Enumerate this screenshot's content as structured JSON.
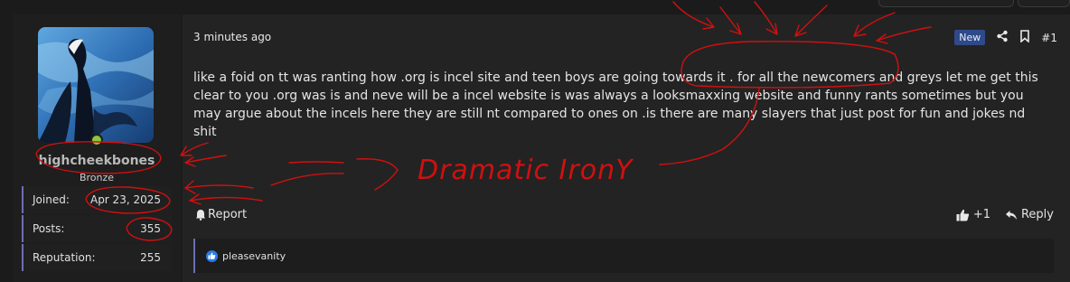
{
  "post": {
    "time": "3 minutes ago",
    "new_badge": "New",
    "number": "#1",
    "content": "like a foid on tt was ranting how .org is incel site and teen boys are going towards it . for all the newcomers and greys let me get this clear to you .org was is and neve will be a incel website is was always a looksmaxxing website and funny rants sometimes but you may argue about the incels here they are still nt compared to ones on .is there are many slayers that just post for fun and jokes nd shit",
    "report_label": "Report",
    "like_count": "+1",
    "reply_label": "Reply",
    "liked_by": "pleasevanity"
  },
  "user": {
    "username": "highcheekbones",
    "rank": "Bronze",
    "stats": [
      {
        "label": "Joined:",
        "value": "Apr 23, 2025"
      },
      {
        "label": "Posts:",
        "value": "355"
      },
      {
        "label": "Reputation:",
        "value": "255"
      }
    ]
  },
  "annotation": {
    "handwritten_text": "Dramatic IronY",
    "ink_color": "#d01010"
  },
  "icons": [
    "share-icon",
    "bookmark-icon",
    "bell-icon",
    "thumbs-up-icon",
    "reply-arrow-icon",
    "like-reaction-icon"
  ]
}
